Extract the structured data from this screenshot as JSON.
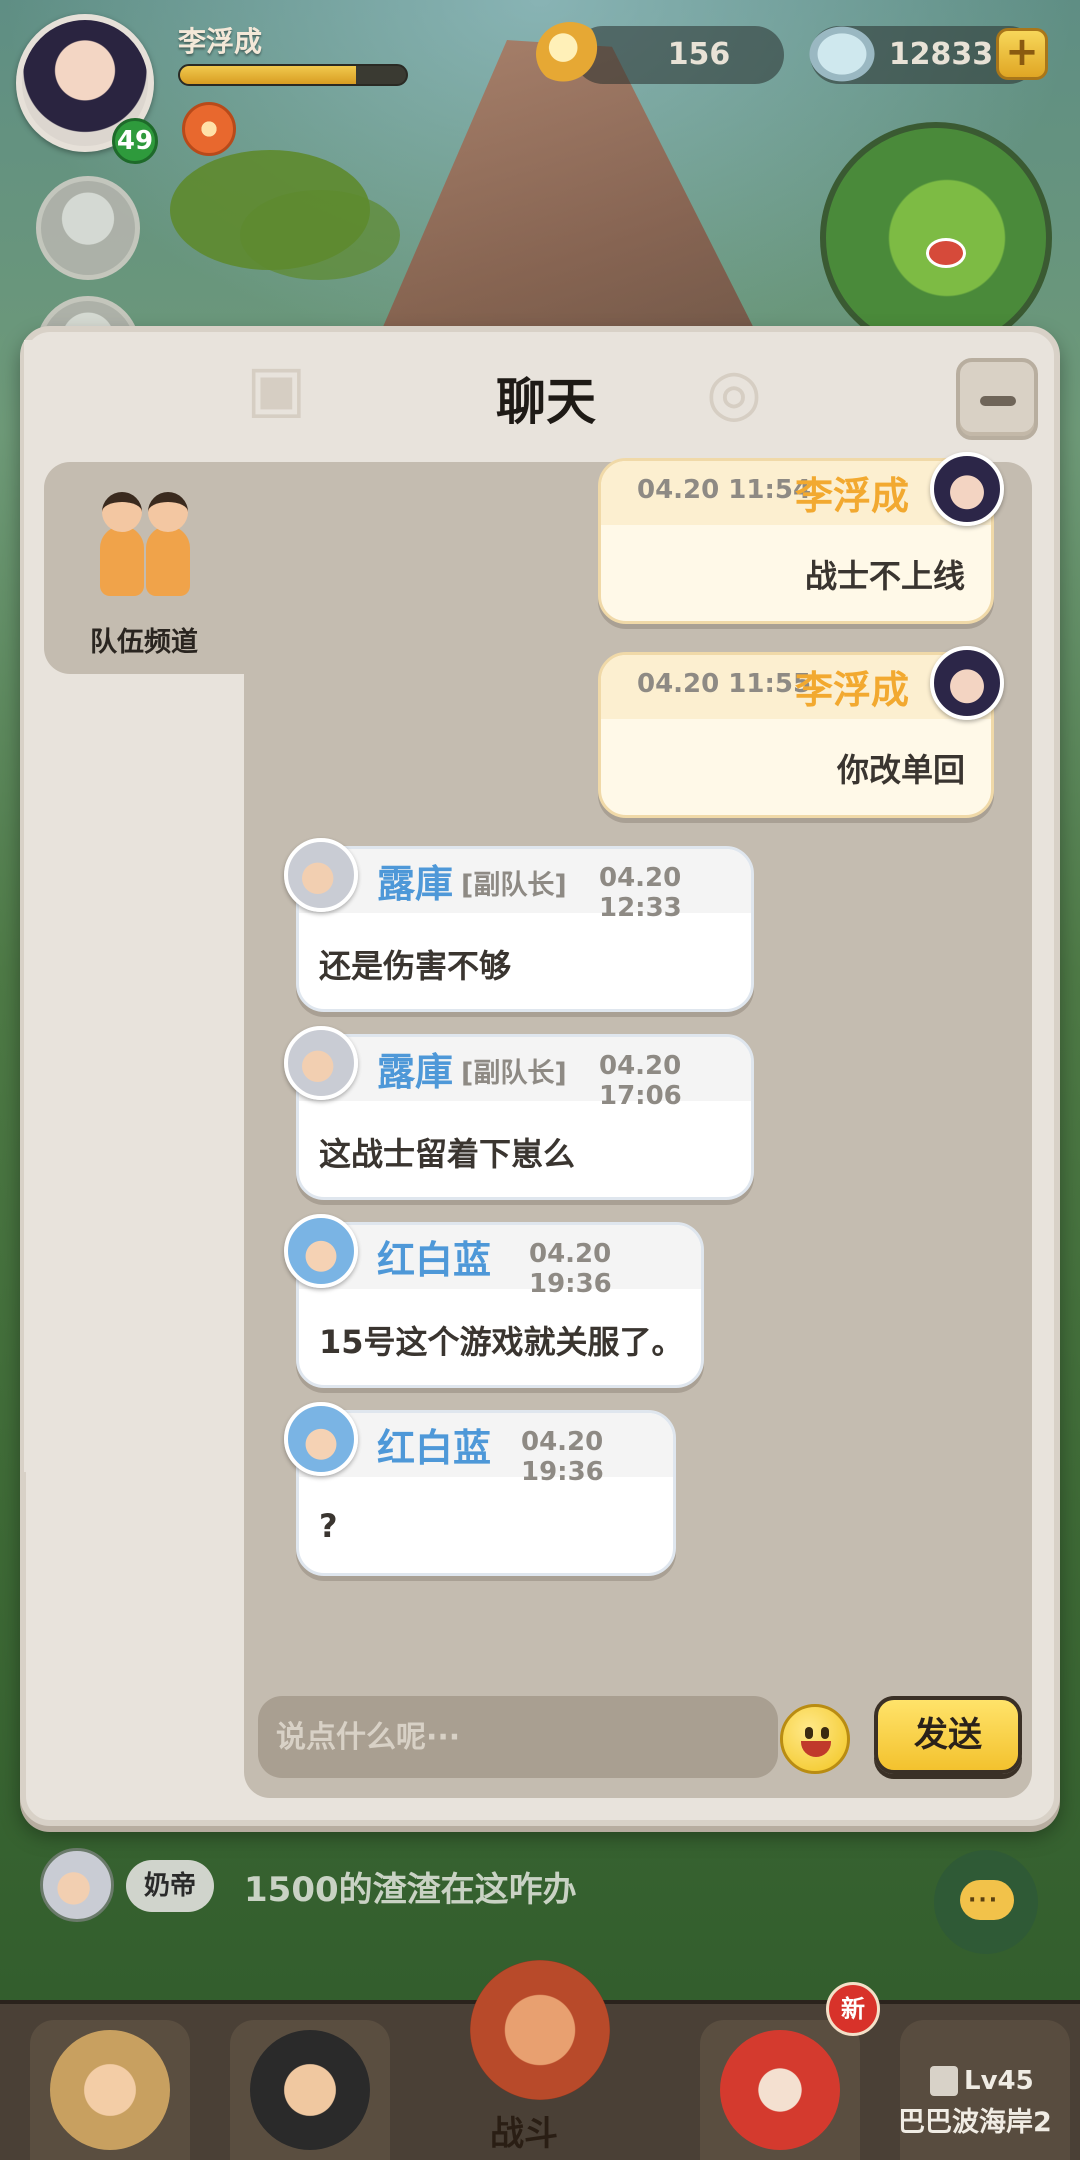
{
  "hud": {
    "player_name": "李浮成",
    "level": "49",
    "xp_progress": 0.78,
    "currency_1": "156",
    "currency_2": "12833",
    "plus_label": "+"
  },
  "chat_panel": {
    "title": "聊天",
    "channel": "队伍频道",
    "messages": [
      {
        "side": "self",
        "time": "04.20 11:54",
        "name": "李浮成",
        "text": "战士不上线"
      },
      {
        "side": "self",
        "time": "04.20 11:55",
        "name": "李浮成",
        "text": "你改单回"
      },
      {
        "side": "other",
        "time": "04.20 12:33",
        "name": "露庫",
        "role": "[副队长]",
        "text": "还是伤害不够"
      },
      {
        "side": "other",
        "time": "04.20 17:06",
        "name": "露庫",
        "role": "[副队长]",
        "text": "这战士留着下崽么"
      },
      {
        "side": "other",
        "time": "04.20 19:36",
        "name": "红白蓝",
        "text": "15号这个游戏就关服了。"
      },
      {
        "side": "other",
        "time": "04.20 19:36",
        "name": "红白蓝",
        "text": "?"
      }
    ],
    "input_placeholder": "说点什么呢···",
    "send_label": "发送"
  },
  "world_chat": {
    "tag": "奶帝",
    "message": "1500的渣渣在这咋办"
  },
  "bottom_nav": {
    "battle_label": "战斗",
    "new_badge": "新",
    "locked_level": "Lv45",
    "locked_map": "巴巴波海岸2"
  },
  "colors": {
    "self_name": "#f2a930",
    "other_name": "#4e98d8",
    "send_button": "#f3c22e"
  }
}
